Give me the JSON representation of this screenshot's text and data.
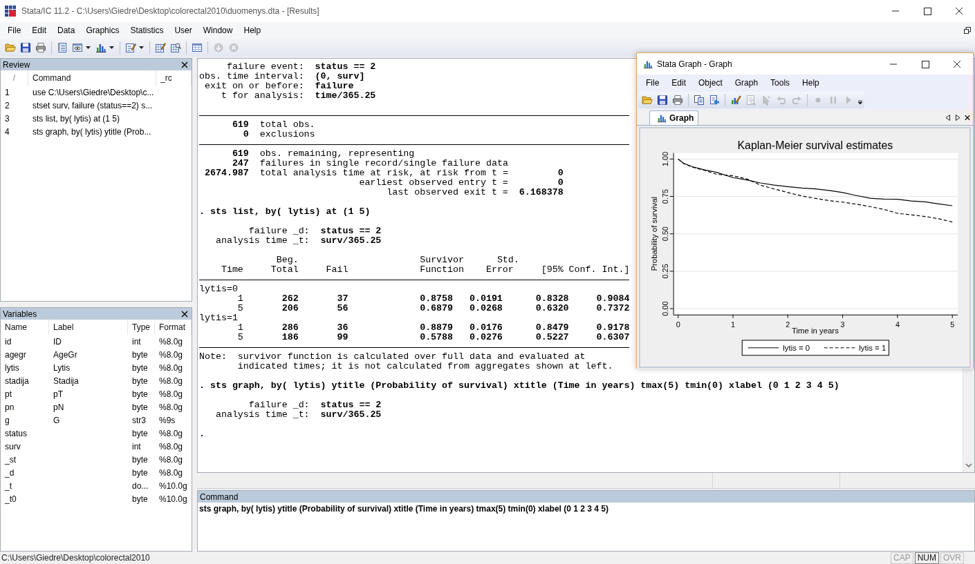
{
  "window": {
    "title": "Stata/IC 11.2 - C:\\Users\\Giedre\\Desktop\\colorectal2010\\duomenys.dta - [Results]"
  },
  "menu": [
    "File",
    "Edit",
    "Data",
    "Graphics",
    "Statistics",
    "User",
    "Window",
    "Help"
  ],
  "toolbar": [
    {
      "kind": "open",
      "disabled": false
    },
    {
      "kind": "save",
      "disabled": false
    },
    {
      "kind": "print",
      "disabled": false
    },
    {
      "kind": "separator"
    },
    {
      "kind": "log",
      "disabled": false
    },
    {
      "kind": "viewer",
      "disabled": false
    },
    {
      "kind": "graph",
      "disabled": false
    },
    {
      "kind": "separator"
    },
    {
      "kind": "dofile",
      "disabled": false
    },
    {
      "kind": "separator"
    },
    {
      "kind": "edit",
      "disabled": false
    },
    {
      "kind": "browse",
      "disabled": false
    },
    {
      "kind": "separator"
    },
    {
      "kind": "variables",
      "disabled": false
    },
    {
      "kind": "separator"
    },
    {
      "kind": "more",
      "disabled": true
    },
    {
      "kind": "break",
      "disabled": true
    }
  ],
  "review": {
    "title": "Review",
    "columns": [
      "/",
      "Command",
      "_rc"
    ],
    "rows": [
      {
        "num": "1",
        "command": "use C:\\Users\\Giedre\\Desktop\\c..."
      },
      {
        "num": "2",
        "command": "stset surv, failure (status==2) s..."
      },
      {
        "num": "3",
        "command": "sts list, by( lytis) at (1 5)"
      },
      {
        "num": "4",
        "command": "sts graph, by( lytis) ytitle (Prob..."
      }
    ]
  },
  "variables": {
    "title": "Variables",
    "columns": [
      "Name",
      "Label",
      "Type",
      "Format"
    ],
    "rows": [
      {
        "name": "id",
        "label": "ID",
        "type": "int",
        "format": "%8.0g"
      },
      {
        "name": "agegr",
        "label": "AgeGr",
        "type": "byte",
        "format": "%8.0g"
      },
      {
        "name": "lytis",
        "label": "Lytis",
        "type": "byte",
        "format": "%8.0g"
      },
      {
        "name": "stadija",
        "label": "Stadija",
        "type": "byte",
        "format": "%8.0g"
      },
      {
        "name": "pt",
        "label": "pT",
        "type": "byte",
        "format": "%8.0g"
      },
      {
        "name": "pn",
        "label": "pN",
        "type": "byte",
        "format": "%8.0g"
      },
      {
        "name": "g",
        "label": "G",
        "type": "str3",
        "format": "%9s"
      },
      {
        "name": "status",
        "type": "byte",
        "format": "%8.0g"
      },
      {
        "name": "surv",
        "type": "int",
        "format": "%8.0g"
      },
      {
        "name": "_st",
        "type": "byte",
        "format": "%8.0g"
      },
      {
        "name": "_d",
        "type": "byte",
        "format": "%8.0g"
      },
      {
        "name": "_t",
        "type": "do...",
        "format": "%10.0g"
      },
      {
        "name": "_t0",
        "type": "byte",
        "format": "%10.0g"
      }
    ]
  },
  "results": [
    {
      "kind": "output",
      "text": "     failure event:  **status == 2**"
    },
    {
      "kind": "output",
      "text": "obs. time interval:  **(0, surv]**"
    },
    {
      "kind": "output",
      "text": " exit on or before:  **failure**"
    },
    {
      "kind": "output",
      "text": "    t for analysis:  **time/365.25**"
    },
    {
      "kind": "blank"
    },
    {
      "kind": "rule"
    },
    {
      "kind": "output",
      "text": "      **619**  total obs."
    },
    {
      "kind": "output",
      "text": "        **0**  exclusions"
    },
    {
      "kind": "rule"
    },
    {
      "kind": "output",
      "text": "      **619**  obs. remaining, representing"
    },
    {
      "kind": "output",
      "text": "      **247**  failures in single record/single failure data"
    },
    {
      "kind": "output",
      "text": " **2674.987**  total analysis time at risk, at risk from t =         **0**"
    },
    {
      "kind": "output",
      "text": "                             earliest observed entry t =         **0**"
    },
    {
      "kind": "output",
      "text": "                                  last observed exit t =  **6.168378**"
    },
    {
      "kind": "blank"
    },
    {
      "kind": "command",
      "text": ". sts list, by( lytis) at (1 5)"
    },
    {
      "kind": "blank"
    },
    {
      "kind": "output",
      "text": "         failure _d:  **status == 2**"
    },
    {
      "kind": "output",
      "text": "   analysis time _t:  **surv/365.25**"
    },
    {
      "kind": "blank"
    },
    {
      "kind": "output",
      "text": "              Beg.                      Survivor      Std."
    },
    {
      "kind": "output",
      "text": "    Time     Total     Fail             Function    Error     [95% Conf. Int.]"
    },
    {
      "kind": "rule"
    },
    {
      "kind": "output",
      "text": "lytis=0"
    },
    {
      "kind": "row",
      "time": "1",
      "values": "262       37             0.8758   0.0191      0.8328     0.9084"
    },
    {
      "kind": "row",
      "time": "5",
      "values": "206       56             0.6879   0.0268      0.6320     0.7372"
    },
    {
      "kind": "output",
      "text": "lytis=1"
    },
    {
      "kind": "row",
      "time": "1",
      "values": "286       36             0.8879   0.0176      0.8479     0.9178"
    },
    {
      "kind": "row",
      "time": "5",
      "values": "186       99             0.5788   0.0276      0.5227     0.6307"
    },
    {
      "kind": "rule"
    },
    {
      "kind": "output",
      "text": "Note:  survivor function is calculated over full data and evaluated at"
    },
    {
      "kind": "output",
      "text": "       indicated times; it is not calculated from aggregates shown at left."
    },
    {
      "kind": "blank"
    },
    {
      "kind": "command",
      "text": ". sts graph, by( lytis) ytitle (Probability of survival) xtitle (Time in years) tmax(5) tmin(0) xlabel (0 1 2 3 4 5)"
    },
    {
      "kind": "blank"
    },
    {
      "kind": "output",
      "text": "         failure _d:  **status == 2**"
    },
    {
      "kind": "output",
      "text": "   analysis time _t:  **surv/365.25**"
    },
    {
      "kind": "blank"
    },
    {
      "kind": "command",
      "text": "."
    }
  ],
  "command_panel": {
    "title": "Command",
    "value": "sts graph, by( lytis) ytitle (Probability of survival) xtitle (Time in years) tmax(5) tmin(0) xlabel (0 1 2 3 4 5)"
  },
  "status_bar": {
    "path": "C:\\Users\\Giedre\\Desktop\\colorectal2010",
    "indicators": [
      {
        "label": "CAP",
        "on": false
      },
      {
        "label": "NUM",
        "on": true
      },
      {
        "label": "OVR",
        "on": false
      }
    ]
  },
  "graph_window": {
    "title": "Stata Graph - Graph",
    "menu": [
      "File",
      "Edit",
      "Object",
      "Graph",
      "Tools",
      "Help"
    ],
    "toolbar": [
      {
        "kind": "open",
        "disabled": false
      },
      {
        "kind": "save",
        "disabled": false
      },
      {
        "kind": "print",
        "disabled": false
      },
      {
        "kind": "separator"
      },
      {
        "kind": "copy",
        "disabled": false
      },
      {
        "kind": "export",
        "disabled": false
      },
      {
        "kind": "separator"
      },
      {
        "kind": "editor",
        "disabled": false
      },
      {
        "kind": "preview",
        "disabled": true
      },
      {
        "kind": "pointer",
        "disabled": true
      },
      {
        "kind": "undo",
        "disabled": true
      },
      {
        "kind": "redo",
        "disabled": true
      },
      {
        "kind": "separator"
      },
      {
        "kind": "record",
        "disabled": true
      },
      {
        "kind": "pause",
        "disabled": true
      },
      {
        "kind": "play",
        "disabled": true
      }
    ],
    "tabs": [
      {
        "label": "Graph",
        "selected": true
      }
    ],
    "chart_data": {
      "type": "line",
      "title": "Kaplan-Meier survival estimates",
      "xlabel": "Time in years",
      "ylabel": "Probability of survival",
      "x": [
        0,
        0.1,
        0.25,
        0.5,
        0.7,
        1,
        1.25,
        1.5,
        1.75,
        2,
        2.25,
        2.5,
        2.75,
        3,
        3.25,
        3.5,
        3.75,
        4,
        4.25,
        4.5,
        4.75,
        5
      ],
      "series": [
        {
          "name": "lytis = 0",
          "color": "#000000",
          "line_style": "solid",
          "values": [
            1,
            0.972,
            0.95,
            0.926,
            0.911,
            0.876,
            0.86,
            0.84,
            0.826,
            0.815,
            0.806,
            0.8,
            0.79,
            0.776,
            0.756,
            0.738,
            0.732,
            0.731,
            0.72,
            0.714,
            0.7,
            0.688
          ]
        },
        {
          "name": "lytis = 1",
          "color": "#000000",
          "line_style": "dashed",
          "values": [
            1,
            0.97,
            0.947,
            0.922,
            0.898,
            0.888,
            0.867,
            0.826,
            0.8,
            0.776,
            0.754,
            0.737,
            0.722,
            0.712,
            0.698,
            0.682,
            0.664,
            0.637,
            0.627,
            0.616,
            0.601,
            0.579
          ]
        }
      ],
      "xlim": [
        -0.09,
        5.1
      ],
      "ylim": [
        -0.04,
        1.04
      ],
      "grid": true,
      "legend": true,
      "xticks": [
        {
          "value": 0,
          "label": "0"
        },
        {
          "value": 1,
          "label": "1"
        },
        {
          "value": 2,
          "label": "2"
        },
        {
          "value": 3,
          "label": "3"
        },
        {
          "value": 4,
          "label": "4"
        },
        {
          "value": 5,
          "label": "5"
        }
      ],
      "yticks": [
        {
          "value": 0,
          "label": "0.00"
        },
        {
          "value": 0.25,
          "label": "0.25"
        },
        {
          "value": 0.5,
          "label": "0.50"
        },
        {
          "value": 0.75,
          "label": "0.75"
        },
        {
          "value": 1,
          "label": "1.00"
        }
      ]
    }
  }
}
